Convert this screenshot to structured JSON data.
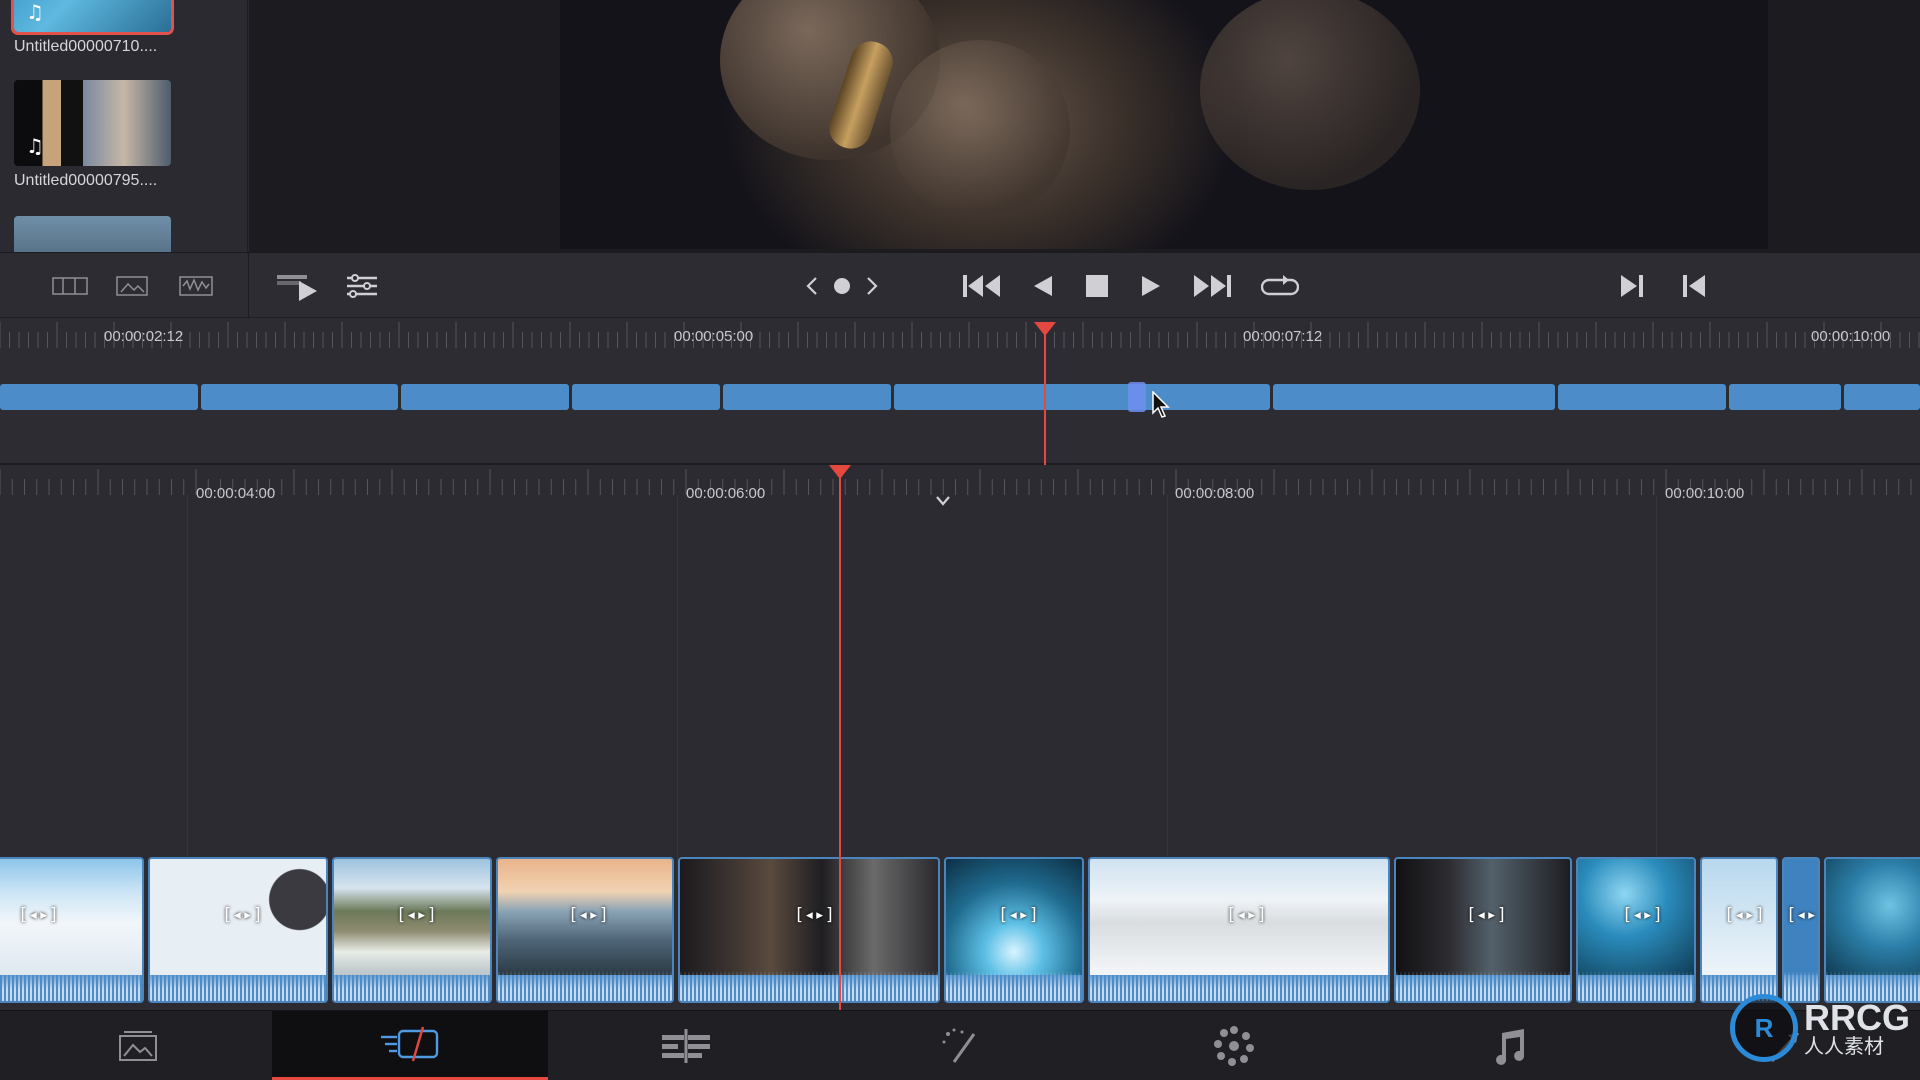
{
  "media_pool": {
    "clips": [
      {
        "name": "Untitled00000710....",
        "selected": true,
        "has_audio": true
      },
      {
        "name": "Untitled00000795....",
        "selected": false,
        "has_audio": true
      },
      {
        "name": "",
        "selected": false,
        "has_audio": false
      }
    ]
  },
  "transport": {
    "music_glyph": "♫"
  },
  "upper_timeline": {
    "timecodes": [
      "00:00:02:12",
      "00:00:05:00",
      "00:00:07:12",
      "00:00:10:00"
    ]
  },
  "lower_timeline": {
    "timecodes": [
      "00:00:04:00",
      "00:00:06:00",
      "00:00:08:00",
      "00:00:10:00"
    ],
    "transition_glyph": "[◂▸]"
  },
  "page_bar": {
    "pages": [
      {
        "name": "media",
        "icon": "media-page-icon",
        "active": false
      },
      {
        "name": "cut",
        "icon": "cut-page-icon",
        "active": true
      },
      {
        "name": "edit",
        "icon": "edit-page-icon",
        "active": false
      },
      {
        "name": "fusion",
        "icon": "fusion-page-icon",
        "active": false
      },
      {
        "name": "color",
        "icon": "color-page-icon",
        "active": false
      },
      {
        "name": "fairlight",
        "icon": "fairlight-page-icon",
        "active": false
      }
    ]
  },
  "watermark": {
    "logo_text": "RRCG",
    "sub_text": "人人素材"
  },
  "colors": {
    "accent": "#e5483f",
    "clip_blue": "#4c8dc9",
    "background": "#2b2b31"
  }
}
